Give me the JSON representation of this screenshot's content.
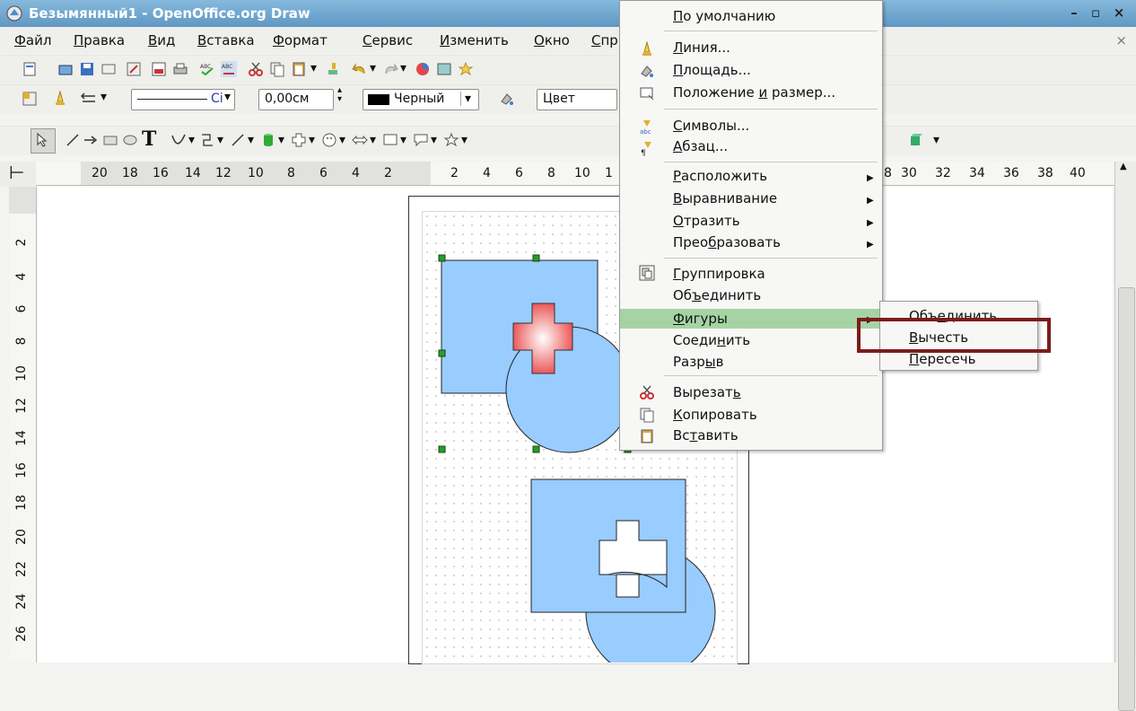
{
  "window": {
    "title": "Безымянный1 - OpenOffice.org Draw"
  },
  "menubar": [
    "Файл",
    "Правка",
    "Вид",
    "Вставка",
    "Формат",
    "Сервис",
    "Изменить",
    "Окно",
    "Спр"
  ],
  "toolbar2": {
    "line_style": "Сі",
    "line_width": "0,00см",
    "color": "Черный",
    "area": "Цвет"
  },
  "hruler": [
    "20",
    "18",
    "16",
    "14",
    "12",
    "10",
    "8",
    "6",
    "4",
    "2",
    "2",
    "4",
    "6",
    "8",
    "10",
    "1",
    "8",
    "30",
    "32",
    "34",
    "36",
    "38",
    "40"
  ],
  "vruler": [
    "2",
    "4",
    "6",
    "8",
    "10",
    "12",
    "14",
    "16",
    "18",
    "20",
    "22",
    "24",
    "26"
  ],
  "context_menu": {
    "default": {
      "pre": "",
      "u": "П",
      "post": "о умолчанию"
    },
    "line": {
      "pre": "",
      "u": "Л",
      "post": "иния..."
    },
    "area": {
      "pre": "",
      "u": "П",
      "post": "лощадь..."
    },
    "position": {
      "pre": "Положение ",
      "u": "и",
      "post": " размер..."
    },
    "characters": {
      "pre": "",
      "u": "С",
      "post": "имволы..."
    },
    "paragraph": {
      "pre": "",
      "u": "А",
      "post": "бзац..."
    },
    "arrange": {
      "pre": "",
      "u": "Р",
      "post": "асположить"
    },
    "alignment": {
      "pre": "",
      "u": "В",
      "post": "ыравнивание"
    },
    "flip": {
      "pre": "",
      "u": "О",
      "post": "тразить"
    },
    "convert": {
      "pre": "Прео",
      "u": "б",
      "post": "разовать"
    },
    "group": {
      "pre": "",
      "u": "Г",
      "post": "руппировка"
    },
    "combine": {
      "pre": "Об",
      "u": "ъ",
      "post": "единить"
    },
    "shapes": {
      "pre": "",
      "u": "Ф",
      "post": "игуры"
    },
    "connect": {
      "pre": "Соеди",
      "u": "н",
      "post": "ить"
    },
    "break": {
      "pre": "Разр",
      "u": "ы",
      "post": "в"
    },
    "cut": {
      "pre": "Вырезат",
      "u": "ь",
      "post": ""
    },
    "copy": {
      "pre": "",
      "u": "К",
      "post": "опировать"
    },
    "paste": {
      "pre": "Вс",
      "u": "т",
      "post": "авить"
    }
  },
  "submenu": {
    "merge": {
      "pre": "Объ",
      "u": "е",
      "post": "динить"
    },
    "subtract": {
      "pre": "",
      "u": "В",
      "post": "ычесть"
    },
    "intersect": {
      "pre": "",
      "u": "П",
      "post": "ересечь"
    }
  },
  "colors": {
    "accent_highlight": "#a6d3a4",
    "annotation": "#7b1d1a",
    "shape_fill": "#99ccff",
    "cross_fill": "#ff6b6b"
  }
}
